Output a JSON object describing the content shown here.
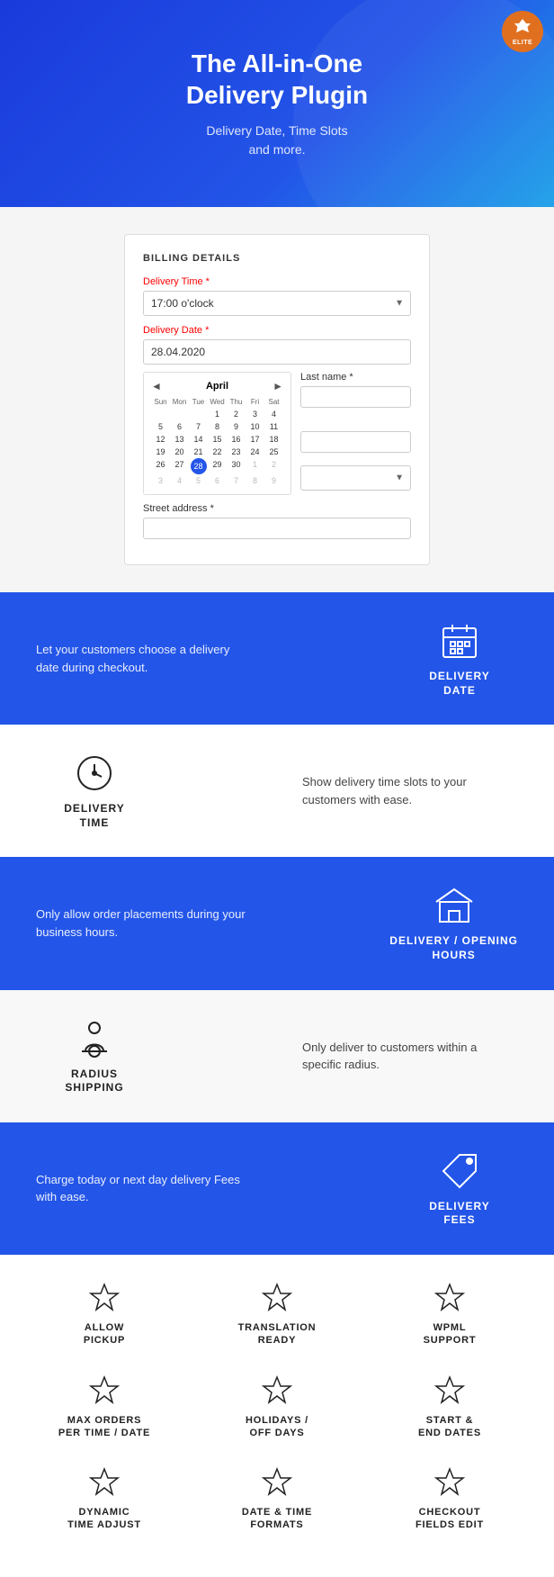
{
  "hero": {
    "title_line1": "The All-in-One",
    "title_line2": "Delivery Plugin",
    "subtitle": "Delivery Date, Time Slots\nand more.",
    "badge": "ELITE"
  },
  "checkout": {
    "billing_title": "BILLING DETAILS",
    "delivery_time_label": "Delivery Time *",
    "delivery_time_value": "17:00 o'clock",
    "delivery_date_label": "Delivery Date *",
    "delivery_date_value": "28.04.2020",
    "calendar": {
      "month": "April",
      "nav_prev": "◄",
      "nav_next": "►",
      "day_headers": [
        "Sun",
        "Mon",
        "Tue",
        "Wed",
        "Thu",
        "Fri",
        "Sat"
      ],
      "weeks": [
        [
          {
            "d": "",
            "cls": "other-month"
          },
          {
            "d": "",
            "cls": "other-month"
          },
          {
            "d": "",
            "cls": "other-month"
          },
          {
            "d": "1",
            "cls": ""
          },
          {
            "d": "2",
            "cls": ""
          },
          {
            "d": "3",
            "cls": ""
          },
          {
            "d": "4",
            "cls": ""
          }
        ],
        [
          {
            "d": "5",
            "cls": ""
          },
          {
            "d": "6",
            "cls": ""
          },
          {
            "d": "7",
            "cls": ""
          },
          {
            "d": "8",
            "cls": ""
          },
          {
            "d": "9",
            "cls": ""
          },
          {
            "d": "10",
            "cls": ""
          },
          {
            "d": "11",
            "cls": ""
          }
        ],
        [
          {
            "d": "12",
            "cls": ""
          },
          {
            "d": "13",
            "cls": ""
          },
          {
            "d": "14",
            "cls": ""
          },
          {
            "d": "15",
            "cls": ""
          },
          {
            "d": "16",
            "cls": ""
          },
          {
            "d": "17",
            "cls": ""
          },
          {
            "d": "18",
            "cls": ""
          }
        ],
        [
          {
            "d": "19",
            "cls": ""
          },
          {
            "d": "20",
            "cls": ""
          },
          {
            "d": "21",
            "cls": ""
          },
          {
            "d": "22",
            "cls": ""
          },
          {
            "d": "23",
            "cls": ""
          },
          {
            "d": "24",
            "cls": ""
          },
          {
            "d": "25",
            "cls": ""
          }
        ],
        [
          {
            "d": "26",
            "cls": ""
          },
          {
            "d": "27",
            "cls": ""
          },
          {
            "d": "28",
            "cls": "selected"
          },
          {
            "d": "29",
            "cls": ""
          },
          {
            "d": "30",
            "cls": ""
          },
          {
            "d": "1",
            "cls": "other-month"
          },
          {
            "d": "2",
            "cls": "other-month"
          }
        ],
        [
          {
            "d": "3",
            "cls": "other-month"
          },
          {
            "d": "4",
            "cls": "other-month"
          },
          {
            "d": "5",
            "cls": "other-month"
          },
          {
            "d": "6",
            "cls": "other-month"
          },
          {
            "d": "7",
            "cls": "other-month"
          },
          {
            "d": "8",
            "cls": "other-month"
          },
          {
            "d": "9",
            "cls": "other-month"
          }
        ]
      ]
    },
    "last_name_label": "Last name *",
    "street_label": "Street address *"
  },
  "features": [
    {
      "id": "delivery-date",
      "text": "Let your customers choose a delivery date during checkout.",
      "label": "DELIVERY\nDATE",
      "blue": true
    },
    {
      "id": "delivery-time",
      "text": "Show delivery time slots to your customers with ease.",
      "label": "DELIVERY\nTIME",
      "blue": false
    },
    {
      "id": "opening-hours",
      "text": "Only allow order placements during your business hours.",
      "label": "DELIVERY / OPENING\nHOURS",
      "blue": true
    },
    {
      "id": "radius-shipping",
      "text": "Only deliver to customers within a specific radius.",
      "label": "RADIUS\nSHIPPING",
      "blue": false
    },
    {
      "id": "delivery-fees",
      "text": "Charge today or next day delivery Fees with ease.",
      "label": "DELIVERY\nFEES",
      "blue": true
    }
  ],
  "feature_grid": {
    "rows": [
      [
        {
          "id": "allow-pickup",
          "label": "ALLOW\nPICKUP"
        },
        {
          "id": "translation-ready",
          "label": "TRANSLATION\nREADY"
        },
        {
          "id": "wpml-support",
          "label": "WPML\nSUPPORT"
        }
      ],
      [
        {
          "id": "max-orders",
          "label": "MAX ORDERS\nPER TIME / DATE"
        },
        {
          "id": "holidays",
          "label": "HOLIDAYS /\nOFF DAYS"
        },
        {
          "id": "start-end-dates",
          "label": "START &\nEND DATES"
        }
      ],
      [
        {
          "id": "dynamic-time",
          "label": "DYNAMIC\nTIME ADJUST"
        },
        {
          "id": "date-time-formats",
          "label": "DATE & TIME\nFORMATS"
        },
        {
          "id": "checkout-fields",
          "label": "CHECKOUT\nFIELDS EDIT"
        }
      ]
    ]
  }
}
